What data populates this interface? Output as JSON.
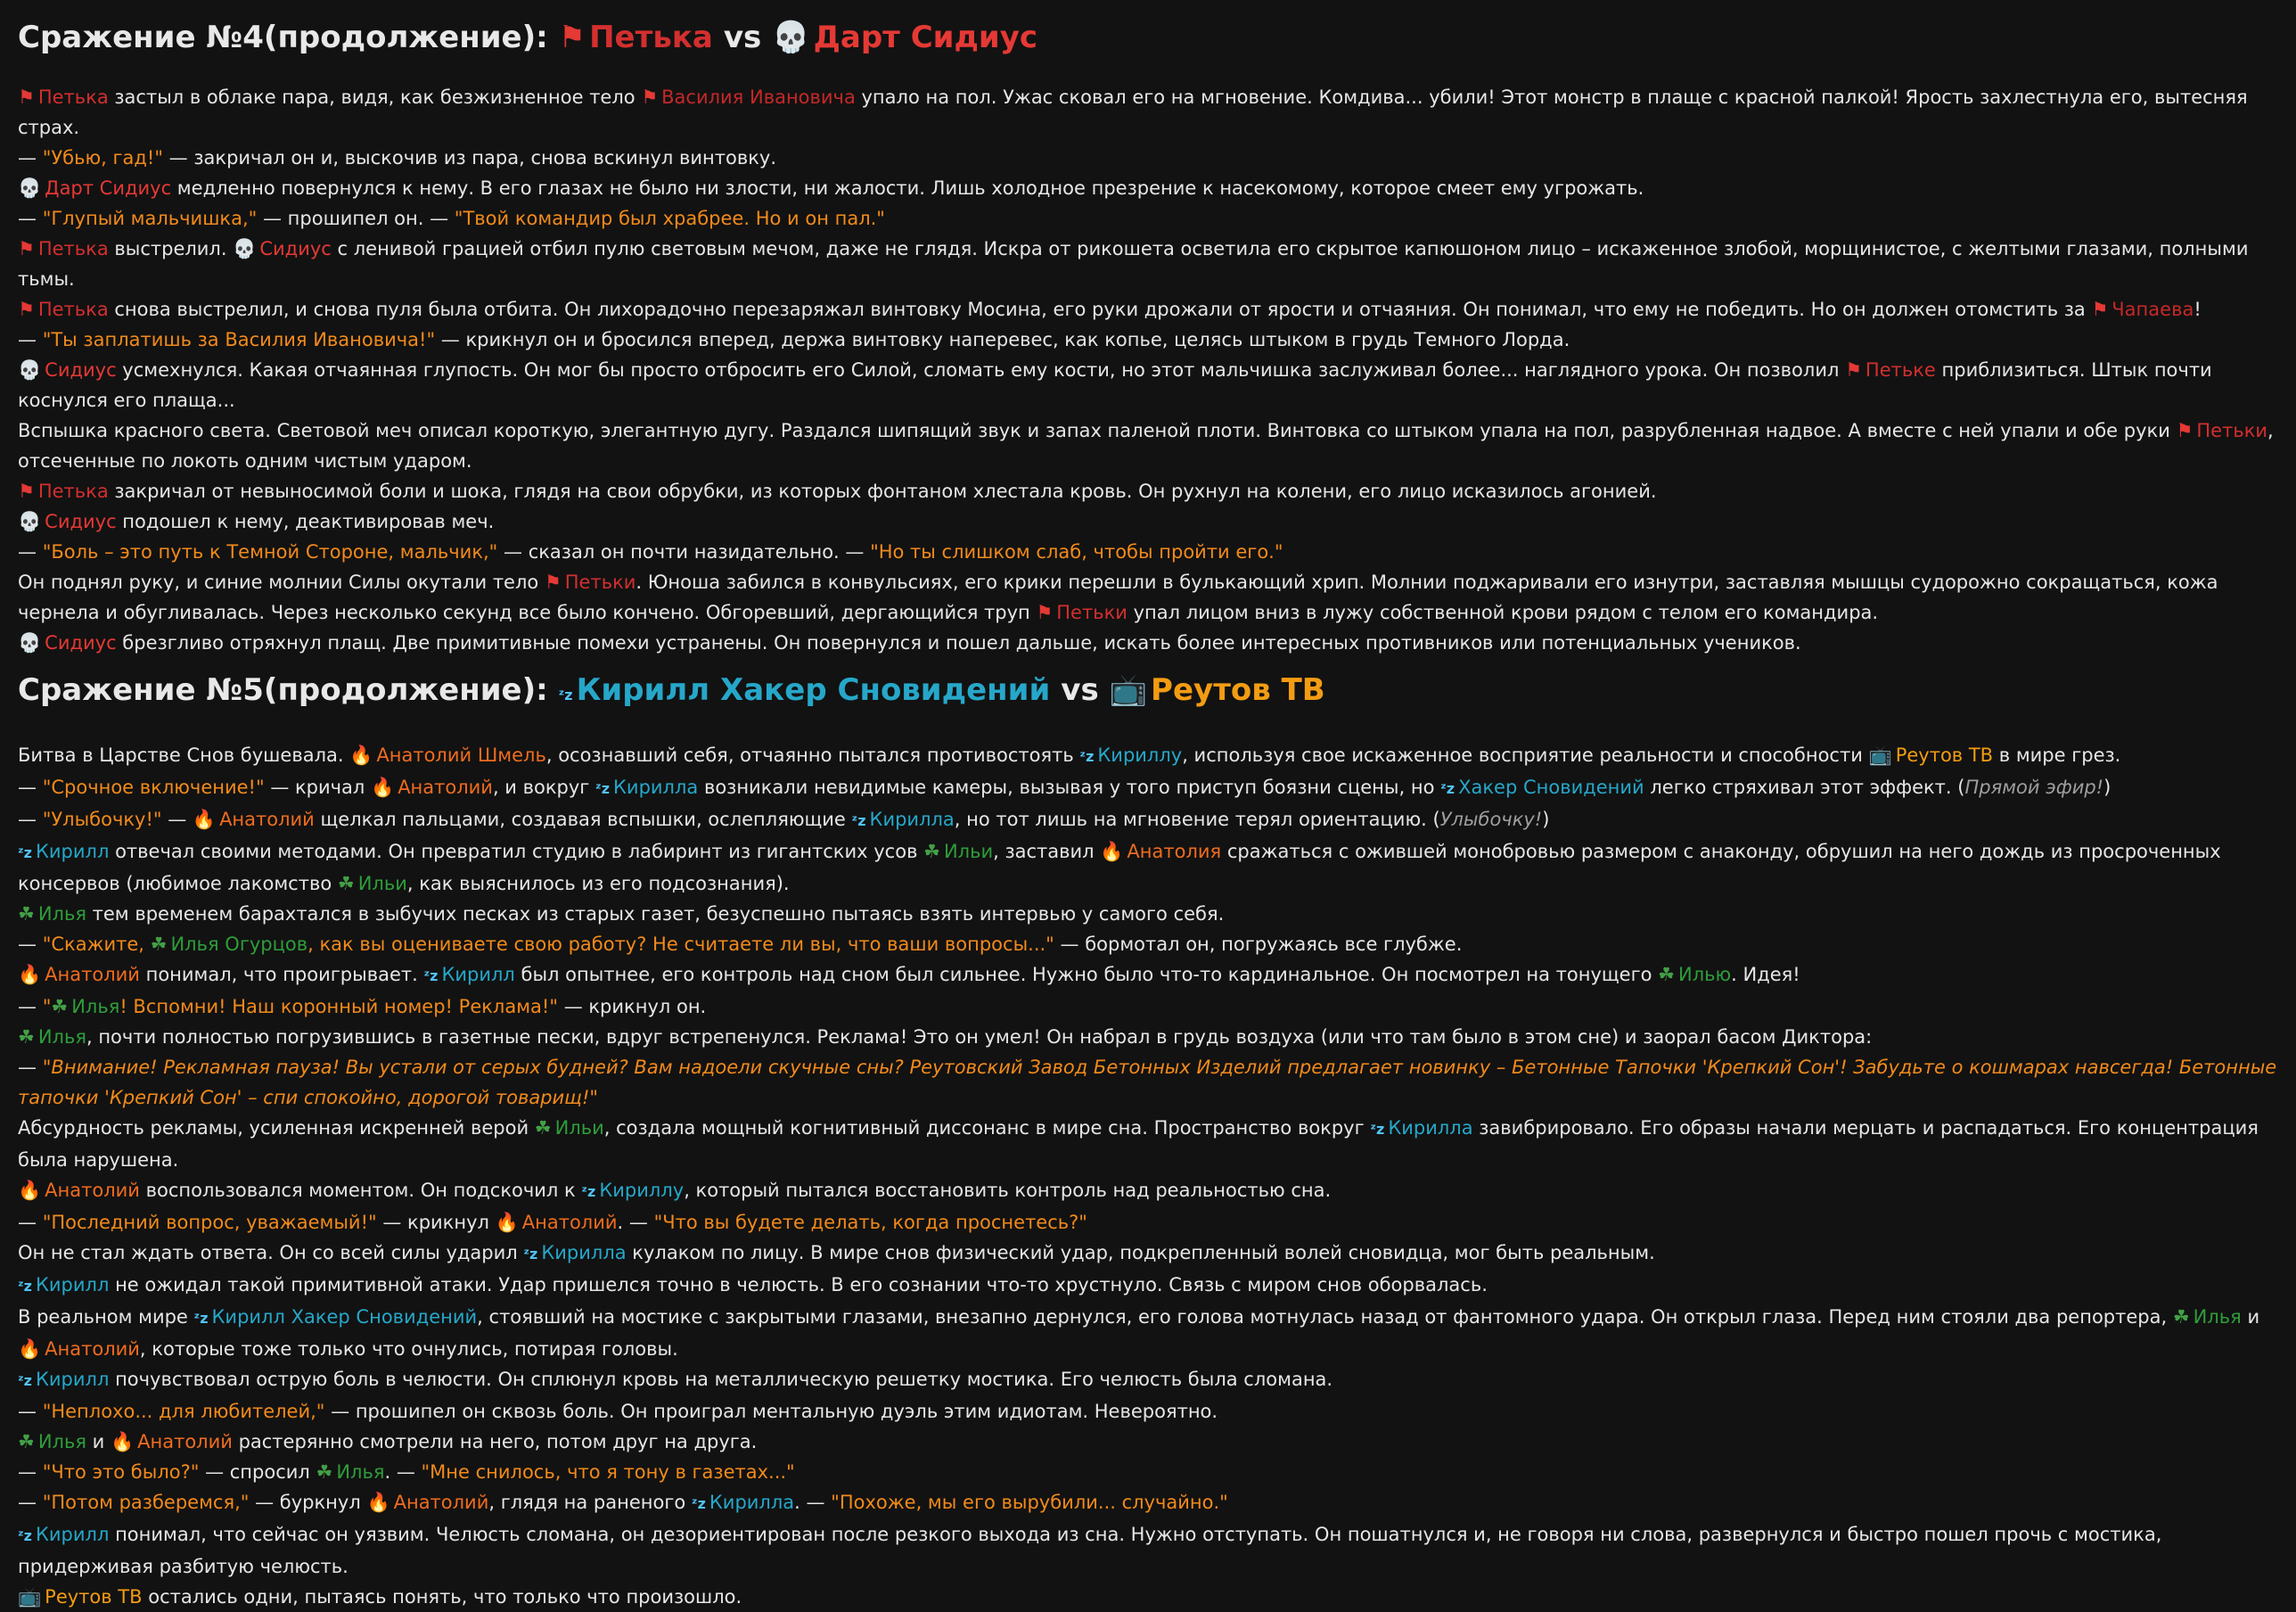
{
  "colors": {
    "background": "#121212",
    "text": "#e6e6e6",
    "petka": "#d32f2f",
    "darth": "#e53935",
    "kirill": "#26a7c9",
    "anatoly": "#ef6c1f",
    "ilya": "#2e9d3a",
    "reutov": "#f39c12",
    "quote": "#f28a1b"
  },
  "icons": {
    "flag": "⚑",
    "skull": "💀",
    "zzz": "ᶻz",
    "fire": "🔥",
    "clover": "☘",
    "tv": "📺"
  },
  "battle4": {
    "title": "Сражение №4(продолжение):",
    "fighter1": "Петька",
    "vs": "vs",
    "fighter2": "Дарт Сидиус",
    "paragraphs": [
      [
        [
          "e",
          "petka",
          "flag",
          "Петька"
        ],
        [
          "t",
          " застыл в облаке пара, видя, как безжизненное тело "
        ],
        [
          "e",
          "vasily",
          "flag",
          "Василия Ивановича"
        ],
        [
          "t",
          " упало на пол. Ужас сковал его на мгновение. Комдива... убили! Этот монстр в плаще с красной палкой! Ярость захлестнула его, вытесняя страх."
        ]
      ],
      [
        [
          "t",
          "— "
        ],
        [
          "q",
          "\"Убью, гад!\""
        ],
        [
          "t",
          " — закричал он и, выскочив из пара, снова вскинул винтовку."
        ]
      ],
      [
        [
          "e",
          "darth",
          "skull",
          "Дарт Сидиус"
        ],
        [
          "t",
          " медленно повернулся к нему. В его глазах не было ни злости, ни жалости. Лишь холодное презрение к насекомому, которое смеет ему угрожать."
        ]
      ],
      [
        [
          "t",
          "— "
        ],
        [
          "q",
          "\"Глупый мальчишка,\""
        ],
        [
          "t",
          " — прошипел он. — "
        ],
        [
          "q",
          "\"Твой командир был храбрее. Но и он пал.\""
        ]
      ],
      [
        [
          "e",
          "petka",
          "flag",
          "Петька"
        ],
        [
          "t",
          " выстрелил. "
        ],
        [
          "e",
          "darth",
          "skull",
          "Сидиус"
        ],
        [
          "t",
          " с ленивой грацией отбил пулю световым мечом, даже не глядя. Искра от рикошета осветила его скрытое капюшоном лицо – искаженное злобой, морщинистое, с желтыми глазами, полными тьмы."
        ]
      ],
      [
        [
          "e",
          "petka",
          "flag",
          "Петька"
        ],
        [
          "t",
          " снова выстрелил, и снова пуля была отбита. Он лихорадочно перезаряжал винтовку Мосина, его руки дрожали от ярости и отчаяния. Он понимал, что ему не победить. Но он должен отомстить за "
        ],
        [
          "e",
          "chapaev",
          "flag",
          "Чапаева"
        ],
        [
          "t",
          "!"
        ]
      ],
      [
        [
          "t",
          "— "
        ],
        [
          "q",
          "\"Ты заплатишь за Василия Ивановича!\""
        ],
        [
          "t",
          " — крикнул он и бросился вперед, держа винтовку наперевес, как копье, целясь штыком в грудь Темного Лорда."
        ]
      ],
      [
        [
          "e",
          "darth",
          "skull",
          "Сидиус"
        ],
        [
          "t",
          " усмехнулся. Какая отчаянная глупость. Он мог бы просто отбросить его Силой, сломать ему кости, но этот мальчишка заслуживал более... наглядного урока. Он позволил "
        ],
        [
          "e",
          "petka",
          "flag",
          "Петьке"
        ],
        [
          "t",
          " приблизиться. Штык почти коснулся его плаща..."
        ]
      ],
      [
        [
          "t",
          "Вспышка красного света. Световой меч описал короткую, элегантную дугу. Раздался шипящий звук и запах паленой плоти. Винтовка со штыком упала на пол, разрубленная надвое. А вместе с ней упали и обе руки "
        ],
        [
          "e",
          "petka",
          "flag",
          "Петьки"
        ],
        [
          "t",
          ", отсеченные по локоть одним чистым ударом."
        ]
      ],
      [
        [
          "e",
          "petka",
          "flag",
          "Петька"
        ],
        [
          "t",
          " закричал от невыносимой боли и шока, глядя на свои обрубки, из которых фонтаном хлестала кровь. Он рухнул на колени, его лицо исказилось агонией."
        ]
      ],
      [
        [
          "e",
          "darth",
          "skull",
          "Сидиус"
        ],
        [
          "t",
          " подошел к нему, деактивировав меч."
        ]
      ],
      [
        [
          "t",
          "— "
        ],
        [
          "q",
          "\"Боль – это путь к Темной Стороне, мальчик,\""
        ],
        [
          "t",
          " — сказал он почти назидательно. — "
        ],
        [
          "q",
          "\"Но ты слишком слаб, чтобы пройти его.\""
        ]
      ],
      [
        [
          "t",
          "Он поднял руку, и синие молнии Силы окутали тело "
        ],
        [
          "e",
          "petka",
          "flag",
          "Петьки"
        ],
        [
          "t",
          ". Юноша забился в конвульсиях, его крики перешли в булькающий хрип. Молнии поджаривали его изнутри, заставляя мышцы судорожно сокращаться, кожа чернела и обугливалась. Через несколько секунд все было кончено. Обгоревший, дергающийся труп "
        ],
        [
          "e",
          "petka",
          "flag",
          "Петьки"
        ],
        [
          "t",
          " упал лицом вниз в лужу собственной крови рядом с телом его командира."
        ]
      ],
      [
        [
          "e",
          "darth",
          "skull",
          "Сидиус"
        ],
        [
          "t",
          " брезгливо отряхнул плащ. Две примитивные помехи устранены. Он повернулся и пошел дальше, искать более интересных противников или потенциальных учеников."
        ]
      ]
    ]
  },
  "battle5": {
    "title": "Сражение №5(продолжение):",
    "fighter1": "Кирилл Хакер Сновидений",
    "vs": "vs",
    "fighter2": "Реутов ТВ",
    "paragraphs": [
      [
        [
          "t",
          "Битва в Царстве Снов бушевала. "
        ],
        [
          "e",
          "anatoly",
          "fire",
          "Анатолий Шмель"
        ],
        [
          "t",
          ", осознавший себя, отчаянно пытался противостоять "
        ],
        [
          "e",
          "kirill",
          "zzz",
          "Кириллу"
        ],
        [
          "t",
          ", используя свое искаженное восприятие реальности и способности "
        ],
        [
          "e",
          "reutov",
          "tv",
          "Реутов ТВ"
        ],
        [
          "t",
          " в мире грез."
        ]
      ],
      [
        [
          "t",
          "— "
        ],
        [
          "q",
          "\"Срочное включение!\""
        ],
        [
          "t",
          " — кричал "
        ],
        [
          "e",
          "anatoly",
          "fire",
          "Анатолий"
        ],
        [
          "t",
          ", и вокруг "
        ],
        [
          "e",
          "kirill",
          "zzz",
          "Кирилла"
        ],
        [
          "t",
          " возникали невидимые камеры, вызывая у того приступ боязни сцены, но "
        ],
        [
          "e",
          "kirill",
          "zzz",
          "Хакер Сновидений"
        ],
        [
          "t",
          " легко стряхивал этот эффект. ("
        ],
        [
          "i",
          "Прямой эфир!"
        ],
        [
          "t",
          ")"
        ]
      ],
      [
        [
          "t",
          "— "
        ],
        [
          "q",
          "\"Улыбочку!\""
        ],
        [
          "t",
          " — "
        ],
        [
          "e",
          "anatoly",
          "fire",
          "Анатолий"
        ],
        [
          "t",
          " щелкал пальцами, создавая вспышки, ослепляющие "
        ],
        [
          "e",
          "kirill",
          "zzz",
          "Кирилла"
        ],
        [
          "t",
          ", но тот лишь на мгновение терял ориентацию. ("
        ],
        [
          "i",
          "Улыбочку!"
        ],
        [
          "t",
          ")"
        ]
      ],
      [
        [
          "e",
          "kirill",
          "zzz",
          "Кирилл"
        ],
        [
          "t",
          " отвечал своими методами. Он превратил студию в лабиринт из гигантских усов "
        ],
        [
          "e",
          "ilya",
          "clover",
          "Ильи"
        ],
        [
          "t",
          ", заставил "
        ],
        [
          "e",
          "anatoly",
          "fire",
          "Анатолия"
        ],
        [
          "t",
          " сражаться с ожившей монобровью размером с анаконду, обрушил на него дождь из просроченных консервов (любимое лакомство "
        ],
        [
          "e",
          "ilya",
          "clover",
          "Ильи"
        ],
        [
          "t",
          ", как выяснилось из его подсознания)."
        ]
      ],
      [
        [
          "e",
          "ilya",
          "clover",
          "Илья"
        ],
        [
          "t",
          " тем временем барахтался в зыбучих песках из старых газет, безуспешно пытаясь взять интервью у самого себя."
        ]
      ],
      [
        [
          "t",
          "— "
        ],
        [
          "q",
          "\"Скажите, "
        ],
        [
          "e",
          "ilya",
          "clover",
          "Илья Огурцов"
        ],
        [
          "q",
          ", как вы оцениваете свою работу? Не считаете ли вы, что ваши вопросы...\""
        ],
        [
          "t",
          " — бормотал он, погружаясь все глубже."
        ]
      ],
      [
        [
          "e",
          "anatoly",
          "fire",
          "Анатолий"
        ],
        [
          "t",
          " понимал, что проигрывает. "
        ],
        [
          "e",
          "kirill",
          "zzz",
          "Кирилл"
        ],
        [
          "t",
          " был опытнее, его контроль над сном был сильнее. Нужно было что-то кардинальное. Он посмотрел на тонущего "
        ],
        [
          "e",
          "ilya",
          "clover",
          "Илью"
        ],
        [
          "t",
          ". Идея!"
        ]
      ],
      [
        [
          "t",
          "— "
        ],
        [
          "q",
          "\""
        ],
        [
          "e",
          "ilya",
          "clover",
          "Илья"
        ],
        [
          "q",
          "! Вспомни! Наш коронный номер! Реклама!\""
        ],
        [
          "t",
          " — крикнул он."
        ]
      ],
      [
        [
          "e",
          "ilya",
          "clover",
          "Илья"
        ],
        [
          "t",
          ", почти полностью погрузившись в газетные пески, вдруг встрепенулся. Реклама! Это он умел! Он набрал в грудь воздуха (или что там было в этом сне) и заорал басом Диктора:"
        ]
      ],
      [
        [
          "t",
          "— "
        ],
        [
          "qi",
          "\"Внимание! Рекламная пауза! Вы устали от серых будней? Вам надоели скучные сны? Реутовский Завод Бетонных Изделий предлагает новинку – Бетонные Тапочки 'Крепкий Сон'! Забудьте о кошмарах навсегда! Бетонные тапочки 'Крепкий Сон' – спи спокойно, дорогой товарищ!\""
        ]
      ],
      [
        [
          "t",
          "Абсурдность рекламы, усиленная искренней верой "
        ],
        [
          "e",
          "ilya",
          "clover",
          "Ильи"
        ],
        [
          "t",
          ", создала мощный когнитивный диссонанс в мире сна. Пространство вокруг "
        ],
        [
          "e",
          "kirill",
          "zzz",
          "Кирилла"
        ],
        [
          "t",
          " завибрировало. Его образы начали мерцать и распадаться. Его концентрация была нарушена."
        ]
      ],
      [
        [
          "e",
          "anatoly",
          "fire",
          "Анатолий"
        ],
        [
          "t",
          " воспользовался моментом. Он подскочил к "
        ],
        [
          "e",
          "kirill",
          "zzz",
          "Кириллу"
        ],
        [
          "t",
          ", который пытался восстановить контроль над реальностью сна."
        ]
      ],
      [
        [
          "t",
          "— "
        ],
        [
          "q",
          "\"Последний вопрос, уважаемый!\""
        ],
        [
          "t",
          " — крикнул "
        ],
        [
          "e",
          "anatoly",
          "fire",
          "Анатолий"
        ],
        [
          "t",
          ". — "
        ],
        [
          "q",
          "\"Что вы будете делать, когда проснетесь?\""
        ]
      ],
      [
        [
          "t",
          "Он не стал ждать ответа. Он со всей силы ударил "
        ],
        [
          "e",
          "kirill",
          "zzz",
          "Кирилла"
        ],
        [
          "t",
          " кулаком по лицу. В мире снов физический удар, подкрепленный волей сновидца, мог быть реальным."
        ]
      ],
      [
        [
          "e",
          "kirill",
          "zzz",
          "Кирилл"
        ],
        [
          "t",
          " не ожидал такой примитивной атаки. Удар пришелся точно в челюсть. В его сознании что-то хрустнуло. Связь с миром снов оборвалась."
        ]
      ],
      [
        [
          "t",
          "В реальном мире "
        ],
        [
          "e",
          "kirill",
          "zzz",
          "Кирилл Хакер Сновидений"
        ],
        [
          "t",
          ", стоявший на мостике с закрытыми глазами, внезапно дернулся, его голова мотнулась назад от фантомного удара. Он открыл глаза. Перед ним стояли два репортера, "
        ],
        [
          "e",
          "ilya",
          "clover",
          "Илья"
        ],
        [
          "t",
          " и "
        ],
        [
          "e",
          "anatoly",
          "fire",
          "Анатолий"
        ],
        [
          "t",
          ", которые тоже только что очнулись, потирая головы."
        ]
      ],
      [
        [
          "e",
          "kirill",
          "zzz",
          "Кирилл"
        ],
        [
          "t",
          " почувствовал острую боль в челюсти. Он сплюнул кровь на металлическую решетку мостика. Его челюсть была сломана."
        ]
      ],
      [
        [
          "t",
          "— "
        ],
        [
          "q",
          "\"Неплохо... для любителей,\""
        ],
        [
          "t",
          " — прошипел он сквозь боль. Он проиграл ментальную дуэль этим идиотам. Невероятно."
        ]
      ],
      [
        [
          "e",
          "ilya",
          "clover",
          "Илья"
        ],
        [
          "t",
          " и "
        ],
        [
          "e",
          "anatoly",
          "fire",
          "Анатолий"
        ],
        [
          "t",
          " растерянно смотрели на него, потом друг на друга."
        ]
      ],
      [
        [
          "t",
          "— "
        ],
        [
          "q",
          "\"Что это было?\""
        ],
        [
          "t",
          " — спросил "
        ],
        [
          "e",
          "ilya",
          "clover",
          "Илья"
        ],
        [
          "t",
          ". — "
        ],
        [
          "q",
          "\"Мне снилось, что я тону в газетах...\""
        ]
      ],
      [
        [
          "t",
          "— "
        ],
        [
          "q",
          "\"Потом разберемся,\""
        ],
        [
          "t",
          " — буркнул "
        ],
        [
          "e",
          "anatoly",
          "fire",
          "Анатолий"
        ],
        [
          "t",
          ", глядя на раненого "
        ],
        [
          "e",
          "kirill",
          "zzz",
          "Кирилла"
        ],
        [
          "t",
          ". — "
        ],
        [
          "q",
          "\"Похоже, мы его вырубили... случайно.\""
        ]
      ],
      [
        [
          "e",
          "kirill",
          "zzz",
          "Кирилл"
        ],
        [
          "t",
          " понимал, что сейчас он уязвим. Челюсть сломана, он дезориентирован после резкого выхода из сна. Нужно отступать. Он пошатнулся и, не говоря ни слова, развернулся и быстро пошел прочь с мостика, придерживая разбитую челюсть."
        ]
      ],
      [
        [
          "e",
          "reutov",
          "tv",
          "Реутов ТВ"
        ],
        [
          "t",
          " остались одни, пытаясь понять, что только что произошло."
        ]
      ]
    ]
  }
}
